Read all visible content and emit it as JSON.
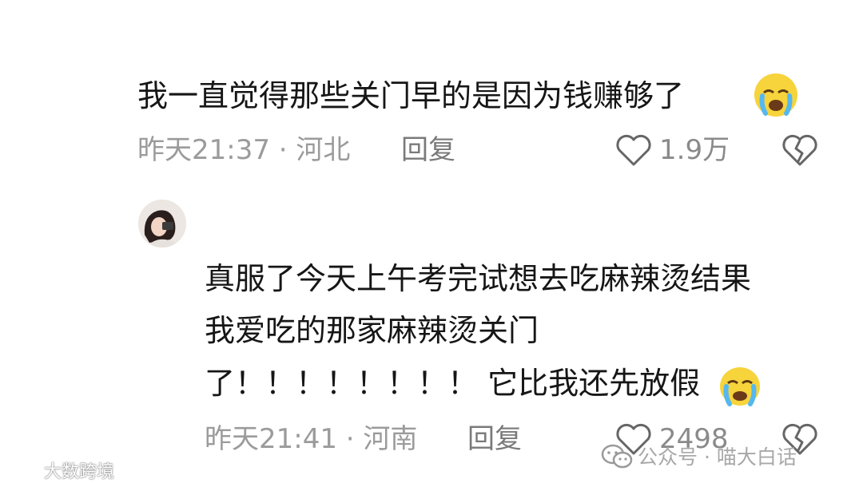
{
  "comment1": {
    "text": "我一直觉得那些关门早的是因为钱赚够了",
    "emoji": "crying-face",
    "time_location": "昨天21:37 · 河北",
    "reply_label": "回复",
    "like_count": "1.9万"
  },
  "comment2": {
    "lines": [
      "真服了今天上午考完试想去吃麻辣烫结果",
      "我爱吃的那家麻辣烫关门",
      "了！！！！！！！！ 它比我还先放假"
    ],
    "emoji": "crying-face",
    "time_location": "昨天21:41 · 河南",
    "reply_label": "回复",
    "like_count": "2498"
  },
  "watermarks": {
    "left": "大数跨境",
    "right": "公众号 · 喵大白话"
  }
}
